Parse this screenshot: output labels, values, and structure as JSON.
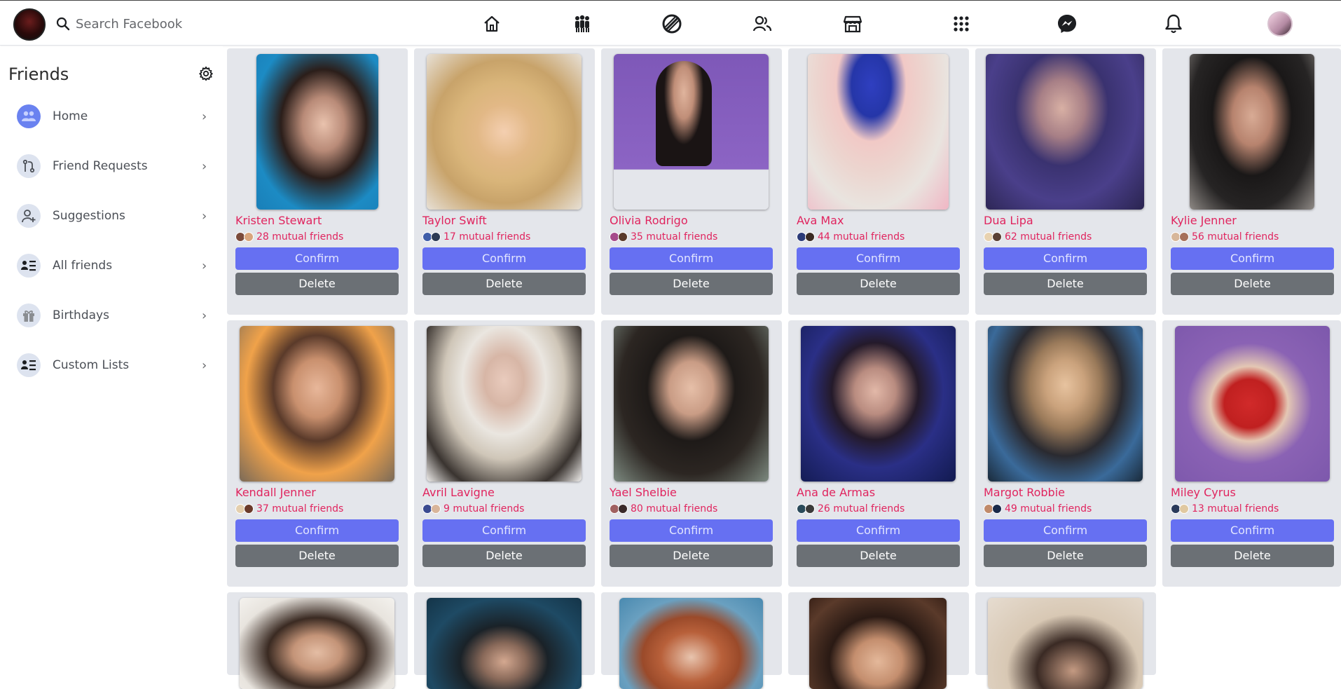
{
  "topbar": {
    "search_placeholder": "Search Facebook",
    "nav_icons": [
      "home-icon",
      "groups-icon",
      "watch-icon",
      "friends-icon",
      "marketplace-icon",
      "apps-grid-icon",
      "messenger-icon",
      "notifications-bell-icon"
    ]
  },
  "sidebar": {
    "title": "Friends",
    "items": [
      {
        "label": "Home",
        "icon": "home-people-icon"
      },
      {
        "label": "Friend Requests",
        "icon": "friend-requests-icon"
      },
      {
        "label": "Suggestions",
        "icon": "suggestions-add-person-icon"
      },
      {
        "label": "All friends",
        "icon": "all-friends-list-icon"
      },
      {
        "label": "Birthdays",
        "icon": "gift-icon"
      },
      {
        "label": "Custom Lists",
        "icon": "custom-list-icon"
      }
    ]
  },
  "buttons": {
    "confirm": "Confirm",
    "delete": "Delete"
  },
  "friends": [
    {
      "name": "Kristen Stewart",
      "mutual": "28 mutual friends"
    },
    {
      "name": "Taylor Swift",
      "mutual": "17 mutual friends"
    },
    {
      "name": "Olivia Rodrigo",
      "mutual": "35 mutual friends"
    },
    {
      "name": "Ava Max",
      "mutual": "44 mutual friends"
    },
    {
      "name": "Dua Lipa",
      "mutual": "62 mutual friends"
    },
    {
      "name": "Kylie Jenner",
      "mutual": "56 mutual friends"
    },
    {
      "name": "Kendall Jenner",
      "mutual": "37 mutual friends"
    },
    {
      "name": "Avril Lavigne",
      "mutual": "9 mutual friends"
    },
    {
      "name": "Yael Shelbie",
      "mutual": "80 mutual friends"
    },
    {
      "name": "Ana de Armas",
      "mutual": "26 mutual friends"
    },
    {
      "name": "Margot Robbie",
      "mutual": "49 mutual friends"
    },
    {
      "name": "Miley Cyrus",
      "mutual": "13 mutual friends"
    }
  ],
  "colors": {
    "accent_name": "#e0245e",
    "confirm_bg": "#6670f2",
    "delete_bg": "#6b7075",
    "card_bg": "#e4e6eb"
  }
}
